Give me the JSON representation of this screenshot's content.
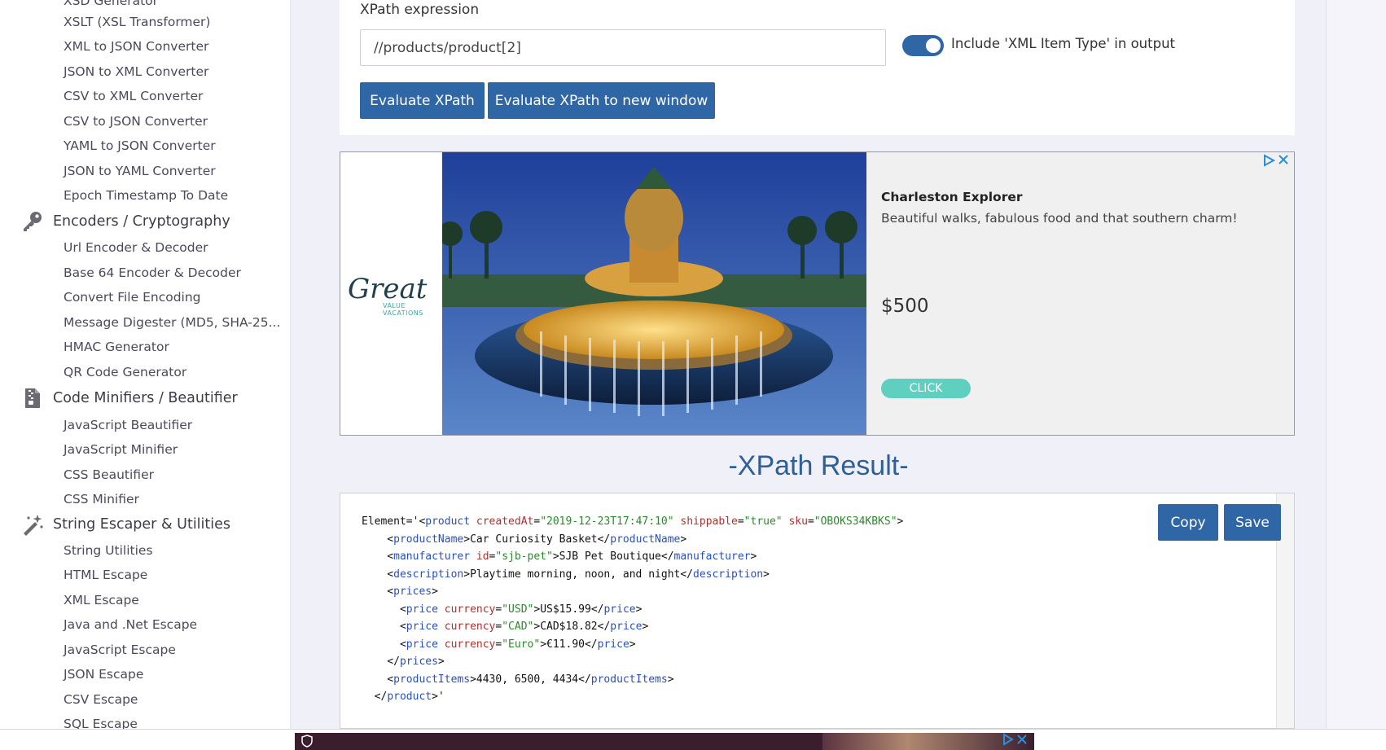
{
  "sidebar": {
    "items": [
      {
        "label": "XSD Generator"
      },
      {
        "label": "XSLT (XSL Transformer)"
      },
      {
        "label": "XML to JSON Converter"
      },
      {
        "label": "JSON to XML Converter"
      },
      {
        "label": "CSV to XML Converter"
      },
      {
        "label": "CSV to JSON Converter"
      },
      {
        "label": "YAML to JSON Converter"
      },
      {
        "label": "JSON to YAML Converter"
      },
      {
        "label": "Epoch Timestamp To Date"
      }
    ],
    "cat_encoders": {
      "label": "Encoders / Cryptography",
      "icon": "key-icon",
      "items": [
        "Url Encoder & Decoder",
        "Base 64 Encoder & Decoder",
        "Convert File Encoding",
        "Message Digester (MD5, SHA-25...",
        "HMAC Generator",
        "QR Code Generator"
      ]
    },
    "cat_minifiers": {
      "label": "Code Minifiers / Beautifier",
      "icon": "zip-file-icon",
      "items": [
        "JavaScript Beautifier",
        "JavaScript Minifier",
        "CSS Beautifier",
        "CSS Minifier"
      ]
    },
    "cat_strings": {
      "label": "String Escaper & Utilities",
      "icon": "magic-wand-icon",
      "items": [
        "String Utilities",
        "HTML Escape",
        "XML Escape",
        "Java and .Net Escape",
        "JavaScript Escape",
        "JSON Escape",
        "CSV Escape",
        "SQL Escape"
      ]
    }
  },
  "xpath": {
    "label": "XPath expression",
    "value": "//products/product[2]",
    "toggle_label": "Include 'XML Item Type' in output",
    "toggle_on": true,
    "evaluate_label": "Evaluate XPath",
    "evaluate_new_label": "Evaluate XPath to new window"
  },
  "ad": {
    "brand": "Great",
    "brand_sub": "VALUE VACATIONS",
    "title": "Charleston Explorer",
    "description": "Beautiful walks, fabulous food and that southern charm!",
    "price": "$500",
    "cta": "CLICK"
  },
  "result": {
    "title": "-XPath Result-",
    "copy_label": "Copy",
    "save_label": "Save",
    "lines": {
      "l0_prefix": "Element='<",
      "l0_tag": "product",
      "l0_a1": "createdAt",
      "l0_v1": "\"2019-12-23T17:47:10\"",
      "l0_a2": "shippable",
      "l0_v2": "\"true\"",
      "l0_a3": "sku",
      "l0_v3": "\"OBOKS34KBKS\"",
      "productName_tag": "productName",
      "productName_text": "Car Curiosity Basket",
      "manufacturer_tag": "manufacturer",
      "manufacturer_attr": "id",
      "manufacturer_val": "\"sjb-pet\"",
      "manufacturer_text": "SJB Pet Boutique",
      "description_tag": "description",
      "description_text": "Playtime morning, noon, and night",
      "prices_tag": "prices",
      "price_tag": "price",
      "price_attr": "currency",
      "price1_val": "\"USD\"",
      "price1_text": "US$15.99",
      "price2_val": "\"CAD\"",
      "price2_text": "CAD$18.82",
      "price3_val": "\"Euro\"",
      "price3_text": "€11.90",
      "productItems_tag": "productItems",
      "productItems_text": "4430, 6500, 4434",
      "close_product_tail": "'"
    }
  },
  "colors": {
    "primary": "#2f67a6",
    "result_title": "#2f5f97",
    "cta": "#5fcfc0"
  }
}
